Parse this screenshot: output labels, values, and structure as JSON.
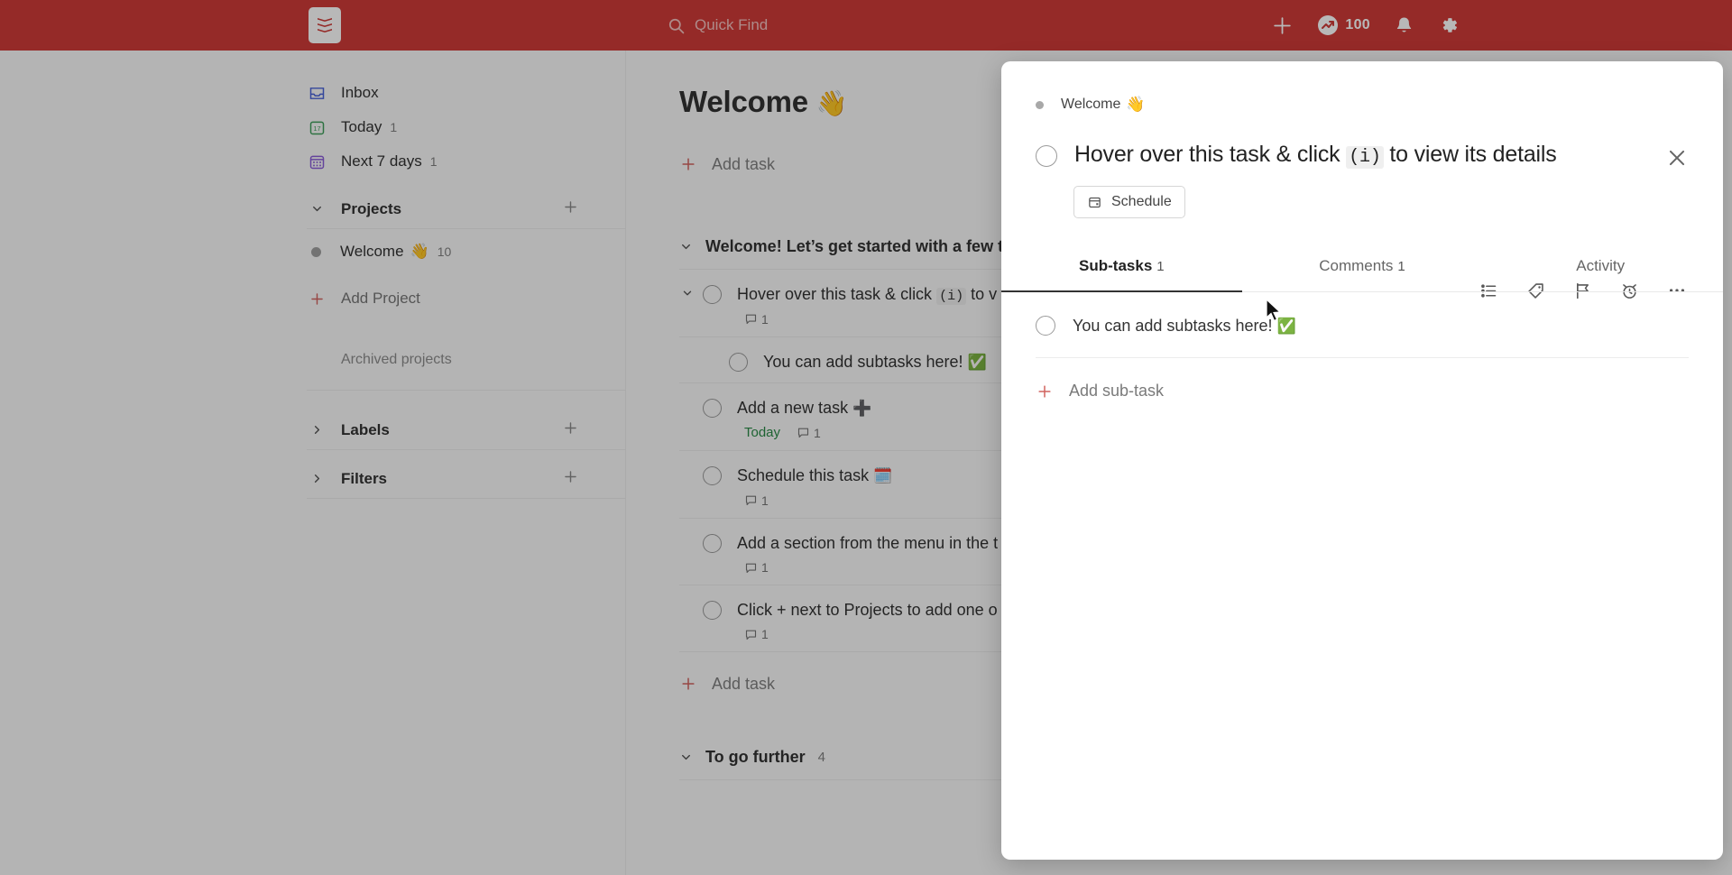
{
  "topbar": {
    "logo_name": "todoist-logo",
    "quick_find_placeholder": "Quick Find",
    "add_label": "+",
    "productivity_count": "100",
    "notifications_label": "notifications",
    "settings_label": "settings",
    "brand_color": "#cf3b38"
  },
  "sidebar": {
    "items": [
      {
        "label": "Inbox",
        "count": "",
        "icon": "inbox-icon"
      },
      {
        "label": "Today",
        "count": "1",
        "icon": "today-calendar-icon"
      },
      {
        "label": "Next 7 days",
        "count": "1",
        "icon": "week-calendar-icon"
      }
    ],
    "projects_section": {
      "label": "Projects",
      "add_label": "+"
    },
    "projects": [
      {
        "label": "Welcome",
        "emoji": "👋",
        "count": "10",
        "color": "#a0a0a0"
      }
    ],
    "add_project_label": "Add Project",
    "archived_label": "Archived projects",
    "labels_section": {
      "label": "Labels",
      "add_label": "+"
    },
    "filters_section": {
      "label": "Filters",
      "add_label": "+"
    }
  },
  "main": {
    "project_title": "Welcome",
    "project_emoji": "👋",
    "add_task_label": "Add task",
    "bottom_add_task_label": "Add task",
    "sections": [
      {
        "title": "Welcome! Let’s get started with a few t",
        "count": "",
        "tasks": [
          {
            "text_before": "Hover over this task & click ",
            "code": "(i)",
            "text_after": " to v",
            "date": "",
            "comments": "1",
            "has_chevron": true,
            "subtask": false
          },
          {
            "text_before": "You can add subtasks here! ",
            "code": "",
            "text_after": "",
            "emoji": "✅",
            "date": "",
            "comments": "",
            "has_chevron": false,
            "subtask": true
          },
          {
            "text_before": "Add a new task ",
            "code": "",
            "text_after": "",
            "emoji": "➕",
            "date": "Today",
            "comments": "1",
            "has_chevron": false,
            "subtask": false
          },
          {
            "text_before": "Schedule this task ",
            "code": "",
            "text_after": "",
            "emoji": "🗓️",
            "date": "",
            "comments": "1",
            "has_chevron": false,
            "subtask": false
          },
          {
            "text_before": "Add a section from the menu in the t",
            "code": "",
            "text_after": "",
            "emoji": "",
            "date": "",
            "comments": "1",
            "has_chevron": false,
            "subtask": false
          },
          {
            "text_before": "Click + next to Projects to add one o",
            "code": "",
            "text_after": "",
            "emoji": "",
            "date": "",
            "comments": "1",
            "has_chevron": false,
            "subtask": false
          }
        ]
      },
      {
        "title": "To go further",
        "count": "4",
        "tasks": []
      }
    ]
  },
  "modal": {
    "breadcrumb_project": "Welcome",
    "breadcrumb_emoji": "👋",
    "title_before": "Hover over this task & click ",
    "title_code": "(i)",
    "title_after": " to view its details",
    "schedule_label": "Schedule",
    "close_label": "Close",
    "actions": [
      "subtasks-icon",
      "label-tag-icon",
      "priority-flag-icon",
      "reminder-alarm-icon",
      "more-options-icon"
    ],
    "tabs": [
      {
        "label": "Sub-tasks",
        "count": "1",
        "active": true
      },
      {
        "label": "Comments",
        "count": "1",
        "active": false
      },
      {
        "label": "Activity",
        "count": "",
        "active": false
      }
    ],
    "subtasks": [
      {
        "text": "You can add subtasks here! ",
        "emoji": "✅"
      }
    ],
    "add_subtask_label": "Add sub-task"
  }
}
